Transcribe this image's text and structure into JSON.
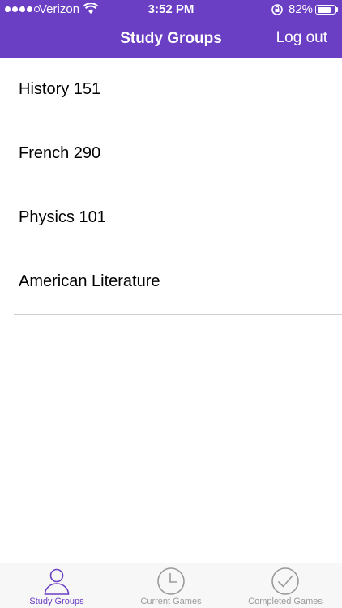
{
  "status_bar": {
    "carrier": "Verizon",
    "time": "3:52 PM",
    "battery_percent": "82%",
    "battery_level": 0.82
  },
  "nav": {
    "title": "Study Groups",
    "logout_label": "Log out"
  },
  "groups": [
    {
      "label": "History 151"
    },
    {
      "label": "French 290"
    },
    {
      "label": "Physics 101"
    },
    {
      "label": "American Literature"
    }
  ],
  "tabs": [
    {
      "label": "Study Groups",
      "icon": "person-icon",
      "active": true
    },
    {
      "label": "Current Games",
      "icon": "clock-icon",
      "active": false
    },
    {
      "label": "Completed Games",
      "icon": "checkmark-icon",
      "active": false
    }
  ],
  "colors": {
    "accent": "#6b3fc4",
    "tab_inactive": "#9a9a9a"
  }
}
